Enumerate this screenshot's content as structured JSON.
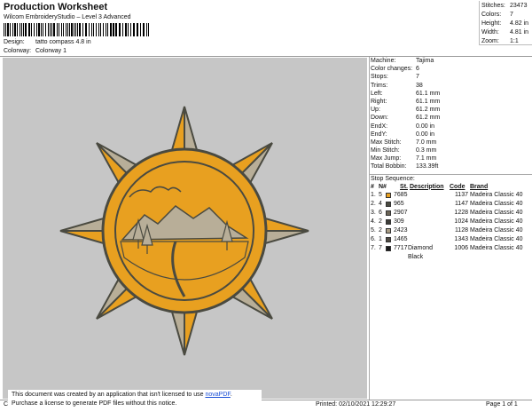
{
  "header": {
    "title": "Production Worksheet",
    "subtitle": "Wilcom EmbroideryStudio – Level 3 Advanced",
    "design_label": "Design:",
    "design_value": "tatto compass 4.8 in",
    "colorway_label": "Colorway:",
    "colorway_value": "Colorway 1"
  },
  "stats": [
    {
      "label": "Stitches:",
      "value": "23473"
    },
    {
      "label": "Colors:",
      "value": "7"
    },
    {
      "label": "Height:",
      "value": "4.82 in"
    },
    {
      "label": "Width:",
      "value": "4.81 in"
    },
    {
      "label": "Zoom:",
      "value": "1:1"
    }
  ],
  "machine": [
    {
      "label": "Machine:",
      "value": "Tajima"
    },
    {
      "label": "Color changes:",
      "value": "6"
    },
    {
      "label": "Stops:",
      "value": "7"
    },
    {
      "label": "Trims:",
      "value": "38"
    },
    {
      "label": "Left:",
      "value": "61.1 mm"
    },
    {
      "label": "Right:",
      "value": "61.1 mm"
    },
    {
      "label": "Up:",
      "value": "61.2 mm"
    },
    {
      "label": "Down:",
      "value": "61.2 mm"
    },
    {
      "label": "EndX:",
      "value": "0.00 in"
    },
    {
      "label": "EndY:",
      "value": "0.00 in"
    },
    {
      "label": "Max Stitch:",
      "value": "7.0 mm"
    },
    {
      "label": "Min Stitch:",
      "value": "0.3 mm"
    },
    {
      "label": "Max Jump:",
      "value": "7.1 mm"
    },
    {
      "label": "Total Bobbin:",
      "value": "133.39ft"
    }
  ],
  "stop_sequence": {
    "title": "Stop Sequence:",
    "columns": {
      "idx": "#",
      "n": "N#",
      "st": "St.",
      "desc": "Description",
      "code": "Code",
      "brand": "Brand"
    },
    "rows": [
      {
        "idx": "1.",
        "n": "5",
        "color": "#E8A020",
        "st": "7685",
        "desc": "",
        "code": "1137",
        "brand": "Madeira Classic 40"
      },
      {
        "idx": "2.",
        "n": "4",
        "color": "#4A4A40",
        "st": "965",
        "desc": "",
        "code": "1147",
        "brand": "Madeira Classic 40"
      },
      {
        "idx": "3.",
        "n": "6",
        "color": "#6B6455",
        "st": "2907",
        "desc": "",
        "code": "1228",
        "brand": "Madeira Classic 40"
      },
      {
        "idx": "4.",
        "n": "2",
        "color": "#3C3C38",
        "st": "309",
        "desc": "",
        "code": "1024",
        "brand": "Madeira Classic 40"
      },
      {
        "idx": "5.",
        "n": "2",
        "color": "#A89C84",
        "st": "2423",
        "desc": "",
        "code": "1128",
        "brand": "Madeira Classic 40"
      },
      {
        "idx": "6.",
        "n": "1",
        "color": "#4F4A42",
        "st": "1465",
        "desc": "",
        "code": "1343",
        "brand": "Madeira Classic 40"
      },
      {
        "idx": "7.",
        "n": "7",
        "color": "#1A1A1A",
        "st": "7717",
        "desc": "Diamond Black",
        "code": "1006",
        "brand": "Madeira Classic 40"
      }
    ]
  },
  "notice": {
    "line1_prefix": "This document was created by an application that isn't licensed to use ",
    "line1_link": "novaPDF",
    "line1_suffix": ".",
    "line2": "Purchase a license to generate PDF files without this notice."
  },
  "footer": {
    "cr": "Cr",
    "printed": "Printed: 02/10/2021 12:29:27",
    "page": "Page 1 of 1"
  },
  "colors": {
    "canvas_bg": "#C6C6C6",
    "sun_gold": "#E8A020",
    "outline_dark": "#4A4A40",
    "ray_light": "#B8AE98"
  }
}
